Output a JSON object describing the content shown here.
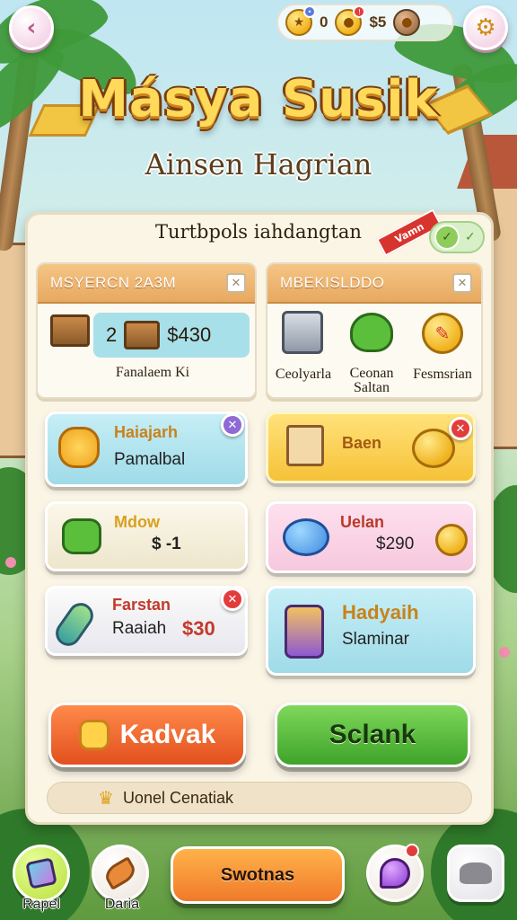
{
  "top_bar": {
    "currency_gem_value": "0",
    "currency_coin_value": "$5",
    "gem_badge": "•",
    "coin_badge": "!"
  },
  "title": "Másya Susik",
  "subtitle": "Ainsen Hagrian",
  "panel": {
    "header": "Turtbpols iahdangtan",
    "corner_banner": "Vamn"
  },
  "left_section": {
    "title": "MSYERCN 2A3M",
    "count": "2",
    "price": "$430",
    "label": "Fanalaem Ki"
  },
  "right_section": {
    "title": "MBEKISLDDO",
    "items": [
      {
        "label": "Ceolyarla"
      },
      {
        "label": "Ceonan Saltan"
      },
      {
        "label": "Fesmsrian"
      }
    ]
  },
  "cards": {
    "c1": {
      "title": "Haiajarh",
      "sub": "Pamalbal"
    },
    "c2": {
      "title": "Baen"
    },
    "c3": {
      "title": "Mdow",
      "price": "$ -1"
    },
    "c4": {
      "title": "Uelan",
      "price": "$290"
    },
    "c5": {
      "title": "Farstan",
      "sub": "Raaiah",
      "price": "$30"
    },
    "c6": {
      "title": "Hadyaih",
      "sub": "Slaminar"
    }
  },
  "buttons": {
    "left": "Kadvak",
    "right": "Sclank"
  },
  "info_bar": "Uonel Cenatiak",
  "bottom_nav": {
    "rapel": "Rapel",
    "daria": "Daria",
    "center": "Swotnas"
  },
  "colors": {
    "accent_orange": "#f07a2a",
    "accent_green": "#5cbf3c",
    "title_gold": "#ffd95a",
    "panel_bg": "#fbf5e6"
  }
}
